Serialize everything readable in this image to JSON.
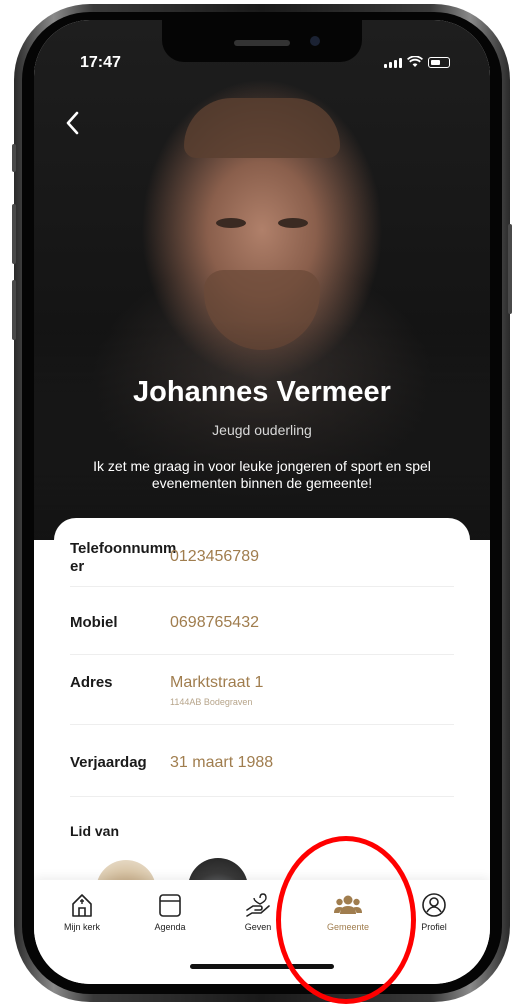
{
  "status_bar": {
    "time": "17:47"
  },
  "profile": {
    "name": "Johannes Vermeer",
    "role": "Jeugd ouderling",
    "bio": "Ik zet me graag in voor leuke jongeren of sport en spel evenementen binnen de gemeente!"
  },
  "details": [
    {
      "label": "Telefoonnumm er",
      "value": "0123456789"
    },
    {
      "label": "Mobiel",
      "value": "0698765432"
    },
    {
      "label": "Adres",
      "value": "Marktstraat 1",
      "sub": "1144AB Bodegraven"
    },
    {
      "label": "Verjaardag",
      "value": "31 maart 1988"
    }
  ],
  "member_of_label": "Lid van",
  "tabs": [
    {
      "label": "Mijn kerk",
      "icon": "church-icon"
    },
    {
      "label": "Agenda",
      "icon": "calendar-icon"
    },
    {
      "label": "Geven",
      "icon": "giving-icon"
    },
    {
      "label": "Gemeente",
      "icon": "community-icon",
      "active": true
    },
    {
      "label": "Profiel",
      "icon": "profile-icon"
    }
  ],
  "colors": {
    "accent": "#a07d4e",
    "highlight_circle": "#ff0000"
  }
}
